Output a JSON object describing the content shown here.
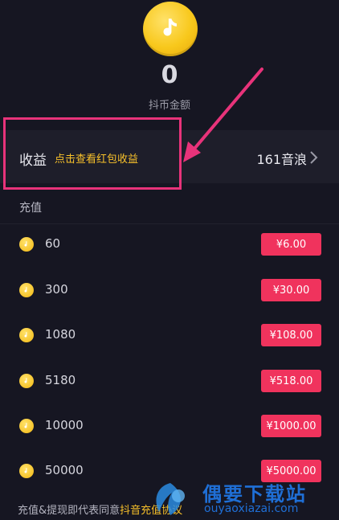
{
  "balance": {
    "value": "0",
    "label": "抖币金额"
  },
  "earnings": {
    "title": "收益",
    "hint": "点击查看红包收益",
    "value": "161音浪"
  },
  "recharge": {
    "section_title": "充值",
    "options": [
      {
        "amount": "60",
        "price": "¥6.00"
      },
      {
        "amount": "300",
        "price": "¥30.00"
      },
      {
        "amount": "1080",
        "price": "¥108.00"
      },
      {
        "amount": "5180",
        "price": "¥518.00"
      },
      {
        "amount": "10000",
        "price": "¥1000.00"
      },
      {
        "amount": "50000",
        "price": "¥5000.00"
      }
    ]
  },
  "footer": {
    "text": "充值&提现即代表同意",
    "link": "抖音充值协议"
  },
  "watermark": {
    "brand": "偶要下载站",
    "domain": "ouyaoxiazai.com"
  },
  "colors": {
    "background": "#161622",
    "price_button": "#f0335d",
    "accent": "#f8c12a",
    "annotation": "#e8337a"
  }
}
